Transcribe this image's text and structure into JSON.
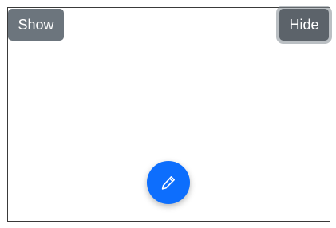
{
  "buttons": {
    "show_label": "Show",
    "hide_label": "Hide"
  },
  "fab": {
    "icon": "pencil-icon",
    "color": "#0d6efd"
  },
  "colors": {
    "show_button": "#6c757d",
    "hide_button": "#5c636a"
  }
}
